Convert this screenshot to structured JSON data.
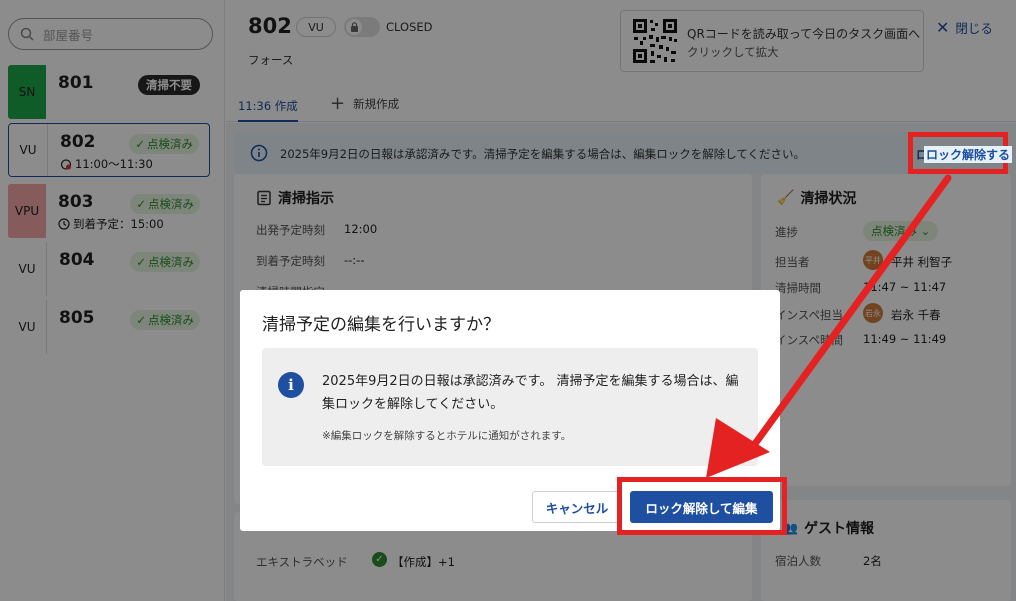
{
  "sidebar": {
    "search_placeholder": "部屋番号",
    "rooms": [
      {
        "tag": "SN",
        "tag_bg": "#1ea84a",
        "tag_color": "#222",
        "number": "801",
        "badge": "清掃不要",
        "badge_style": "dark",
        "sub": ""
      },
      {
        "tag": "VU",
        "tag_bg": "#ffffff",
        "tag_color": "#222",
        "number": "802",
        "badge": "点検済み",
        "badge_style": "ok",
        "sub": "11:00〜11:30",
        "sub_icon": "alarm-icon"
      },
      {
        "tag": "VPU",
        "tag_bg": "#f2a6a6",
        "tag_color": "#222",
        "number": "803",
        "badge": "点検済み",
        "badge_style": "ok",
        "sub": "到着予定：15:00",
        "sub_icon": "clock-icon"
      },
      {
        "tag": "VU",
        "tag_bg": "#ffffff",
        "tag_color": "#222",
        "number": "804",
        "badge": "点検済み",
        "badge_style": "ok",
        "sub": ""
      },
      {
        "tag": "VU",
        "tag_bg": "#ffffff",
        "tag_color": "#222",
        "number": "805",
        "badge": "点検済み",
        "badge_style": "ok",
        "sub": ""
      }
    ]
  },
  "header": {
    "room_number": "802",
    "status_pill": "VU",
    "lock_state": "CLOSED",
    "room_type": "フォース",
    "qr_line1": "QRコードを読み取って今日のタスク画面へ",
    "qr_line2": "クリックして拡大",
    "close_label": "閉じる"
  },
  "tabs": {
    "active": "11:36 作成",
    "new_label": "新規作成"
  },
  "banner": {
    "message": "2025年9月2日の日報は承認済みです。清掃予定を編集する場合は、編集ロックを解除してください。",
    "unlock_link": "ロック解除する"
  },
  "cleaning_instructions": {
    "title": "清掃指示",
    "rows": [
      {
        "label": "出発予定時刻",
        "value": "12:00"
      },
      {
        "label": "到着予定時刻",
        "value": "--:--"
      },
      {
        "label": "清掃時間指定",
        "value": ""
      }
    ]
  },
  "cleaning_status": {
    "title": "清掃状況",
    "progress_label": "進捗",
    "progress_value": "点検済み",
    "rows": [
      {
        "label": "担当者",
        "avatar": "平井",
        "value": "平井 利智子"
      },
      {
        "label": "清掃時間",
        "value": "11:47 ~ 11:47"
      },
      {
        "label": "インスペ担当",
        "avatar": "岩永",
        "value": "岩永 千春"
      },
      {
        "label": "インスペ時間",
        "value": "11:49 ~ 11:49"
      }
    ]
  },
  "amenities": {
    "label": "エキストラベッド",
    "value": "【作成】+1"
  },
  "guest_info": {
    "title": "ゲスト情報",
    "label": "宿泊人数",
    "value": "2名"
  },
  "modal": {
    "title": "清掃予定の編集を行いますか？",
    "message": "2025年9月2日の日報は承認済みです。 清掃予定を編集する場合は、編集ロックを解除してください。",
    "note": "※編集ロックを解除するとホテルに通知がされます。",
    "cancel_label": "キャンセル",
    "confirm_label": "ロック解除して編集"
  },
  "colors": {
    "accent": "#1e4fa0",
    "highlight": "#e52222",
    "ok_green": "#2f8a2f"
  }
}
